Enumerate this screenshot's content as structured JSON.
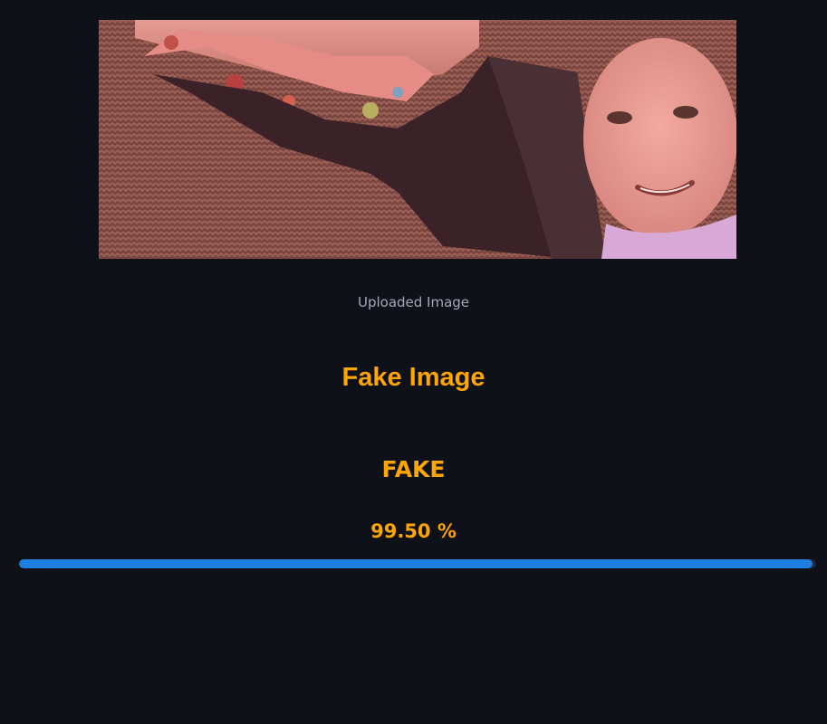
{
  "image": {
    "caption": "Uploaded Image"
  },
  "result": {
    "title": "Fake Image",
    "label": "FAKE",
    "confidence_text": "99.50 %",
    "confidence_fraction": 0.995
  },
  "colors": {
    "background": "#0e1117",
    "accent": "#ffa500",
    "progress": "#1f7fe0",
    "track": "#262730",
    "caption": "#a3a8b8"
  }
}
